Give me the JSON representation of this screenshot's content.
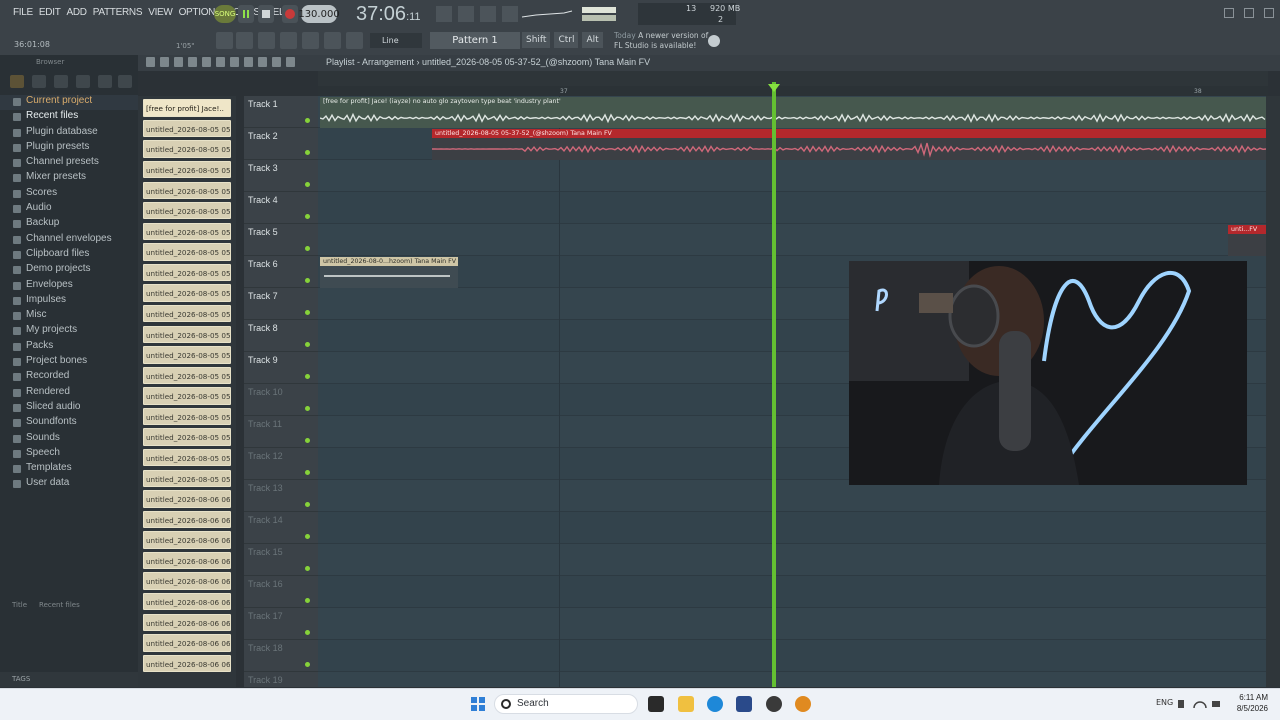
{
  "menu": [
    "FILE",
    "EDIT",
    "ADD",
    "PATTERNS",
    "VIEW",
    "OPTIONS",
    "TOOLS",
    "HELP"
  ],
  "transport": {
    "mode": "SONG",
    "tempo": "130.000",
    "time_main": "37:06",
    "time_sub": "11",
    "cpu": "13",
    "memory": "920 MB",
    "polyphony": "2"
  },
  "hint": {
    "time": "36:01:08",
    "duration": "1'05\""
  },
  "toolbar2": {
    "snap": "Line",
    "pattern": "Pattern 1",
    "modifiers": [
      "Shift",
      "Ctrl",
      "Alt"
    ],
    "news_label": "Today",
    "news_text": "A newer version of FL Studio is available!"
  },
  "browser": {
    "title": "Browser",
    "items": [
      "Current project",
      "Recent files",
      "Plugin database",
      "Plugin presets",
      "Channel presets",
      "Mixer presets",
      "Scores",
      "Audio",
      "Backup",
      "Channel envelopes",
      "Clipboard files",
      "Demo projects",
      "Envelopes",
      "Impulses",
      "Misc",
      "My projects",
      "Packs",
      "Project bones",
      "Recorded",
      "Rendered",
      "Sliced audio",
      "Soundfonts",
      "Sounds",
      "Speech",
      "Templates",
      "User data"
    ],
    "footer": [
      "Title",
      "Recent files"
    ],
    "tags_label": "TAGS"
  },
  "picker": {
    "items": [
      "[free for profit] Jace!..",
      "untitled_2026-08-05 05-...",
      "untitled_2026-08-05 05-...",
      "untitled_2026-08-05 05-...",
      "untitled_2026-08-05 05-...",
      "untitled_2026-08-05 05-...",
      "untitled_2026-08-05 05-...",
      "untitled_2026-08-05 05-...",
      "untitled_2026-08-05 05-...",
      "untitled_2026-08-05 05-...",
      "untitled_2026-08-05 05-...",
      "untitled_2026-08-05 05-...",
      "untitled_2026-08-05 05-...",
      "untitled_2026-08-05 05-...",
      "untitled_2026-08-05 05-...",
      "untitled_2026-08-05 05-...",
      "untitled_2026-08-05 05-...",
      "untitled_2026-08-05 05-...",
      "untitled_2026-08-05 05-...",
      "untitled_2026-08-06 06-...",
      "untitled_2026-08-06 06-...",
      "untitled_2026-08-06 06-...",
      "untitled_2026-08-06 06-...",
      "untitled_2026-08-06 06-...",
      "untitled_2026-08-06 06-...",
      "untitled_2026-08-06 06-...",
      "untitled_2026-08-06 06-...",
      "untitled_2026-08-06 06-..."
    ]
  },
  "playlist": {
    "title": "Playlist - Arrangement › untitled_2026-08-05 05-37-52_(@shzoom) Tana Main FV",
    "ruler": [
      "37",
      "38"
    ],
    "tracks": [
      "Track 1",
      "Track 2",
      "Track 3",
      "Track 4",
      "Track 5",
      "Track 6",
      "Track 7",
      "Track 8",
      "Track 9",
      "Track 10",
      "Track 11",
      "Track 12",
      "Track 13",
      "Track 14",
      "Track 15",
      "Track 16",
      "Track 17",
      "Track 18",
      "Track 19"
    ],
    "clips": {
      "track1": "[free for profit] Jace! (iayze)  no auto  glo  zaytoven type beat 'industry plant'",
      "track2": "untitled_2026-08-05 05-37-52_(@shzoom) Tana Main FV",
      "track5": "unti...FV",
      "track6": "untitled_2026-08-0...hzoom) Tana Main FV"
    }
  },
  "taskbar": {
    "search": "Search",
    "tray_label": "ENG",
    "time": "6:11 AM",
    "date": "8/5/2026"
  },
  "colors": {
    "accent_green": "#64c032",
    "clip_red": "#b4282c",
    "grid_bg": "#34444d"
  }
}
